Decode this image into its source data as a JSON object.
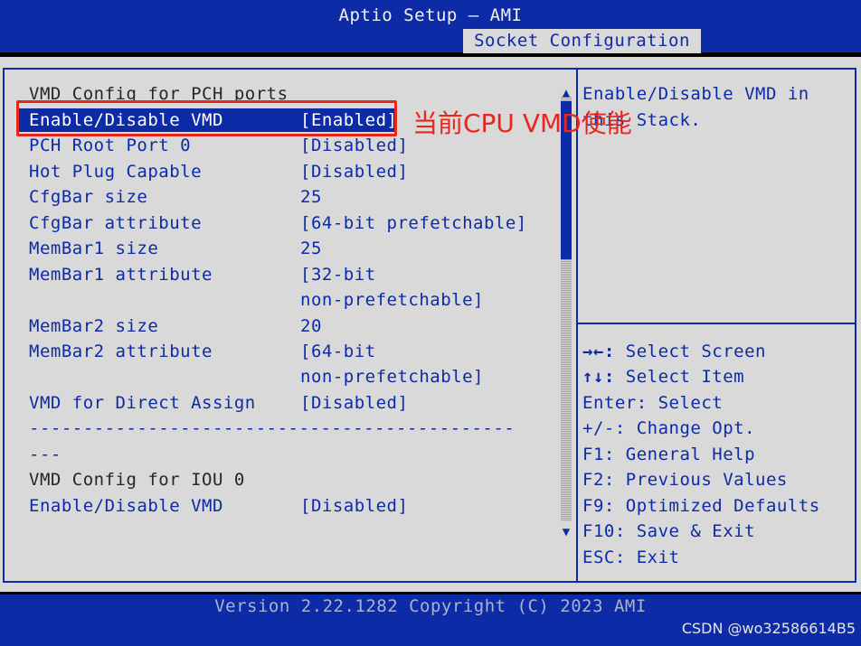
{
  "app": {
    "title": "Aptio Setup – AMI",
    "tab": "Socket Configuration"
  },
  "rows": {
    "heading_pch": "VMD Config for PCH ports",
    "enable_vmd_label": "Enable/Disable VMD",
    "enable_vmd_value": "[Enabled]",
    "pch_root_port_label": "PCH Root Port 0",
    "pch_root_port_value": "[Disabled]",
    "hot_plug_label": "Hot Plug Capable",
    "hot_plug_value": "[Disabled]",
    "cfgbar_size_label": "CfgBar size",
    "cfgbar_size_value": "25",
    "cfgbar_attr_label": "CfgBar attribute",
    "cfgbar_attr_value": "[64-bit prefetchable]",
    "membar1_size_label": "MemBar1 size",
    "membar1_size_value": "25",
    "membar1_attr_label": "MemBar1 attribute",
    "membar1_attr_value_line1": "[32-bit",
    "membar1_attr_value_line2": "non-prefetchable]",
    "membar2_size_label": "MemBar2 size",
    "membar2_size_value": "20",
    "membar2_attr_label": "MemBar2 attribute",
    "membar2_attr_value_line1": "[64-bit",
    "membar2_attr_value_line2": "non-prefetchable]",
    "vmd_direct_label": "VMD for Direct Assign",
    "vmd_direct_value": "[Disabled]",
    "separator": "---------------------------------------------",
    "separator_tail": "---",
    "heading_iou": "VMD Config for IOU 0",
    "iou_enable_vmd_label": "Enable/Disable VMD",
    "iou_enable_vmd_value": "[Disabled]"
  },
  "help": {
    "line1": "Enable/Disable VMD in",
    "line2": "this Stack."
  },
  "keys": [
    {
      "key": "→←:",
      "action": " Select Screen"
    },
    {
      "key": "↑↓:",
      "action": " Select Item"
    },
    {
      "key": "Enter:",
      "action": " Select"
    },
    {
      "key": "+/-:",
      "action": " Change Opt."
    },
    {
      "key": "F1:",
      "action": " General Help"
    },
    {
      "key": "F2:",
      "action": " Previous Values"
    },
    {
      "key": "F9:",
      "action": " Optimized Defaults"
    },
    {
      "key": "F10:",
      "action": " Save & Exit"
    },
    {
      "key": "ESC:",
      "action": " Exit"
    }
  ],
  "annotation": {
    "text": "当前CPU VMD使能",
    "color": "#e8261c"
  },
  "footer": {
    "version": "Version 2.22.1282 Copyright (C) 2023 AMI"
  },
  "watermark": "CSDN @wo32586614B5",
  "icons": {
    "scroll_up": "up-triangle-icon",
    "scroll_down": "down-triangle-icon"
  },
  "colors": {
    "bios_blue": "#0d2aa7",
    "panel_gray": "#d9d9d9",
    "highlight_red": "#e8261c"
  }
}
